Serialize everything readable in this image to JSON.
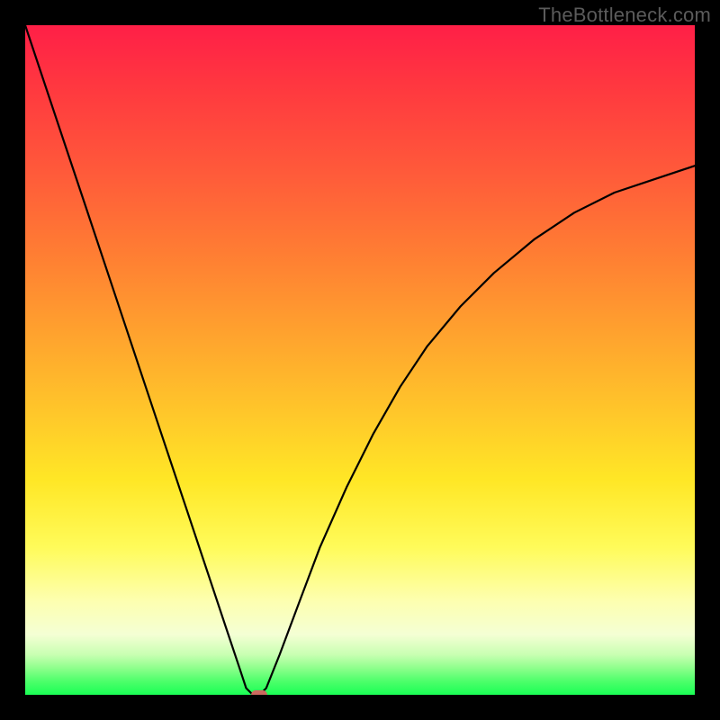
{
  "watermark": {
    "text": "TheBottleneck.com"
  },
  "chart_data": {
    "type": "line",
    "title": "",
    "xlabel": "",
    "ylabel": "",
    "xlim": [
      0,
      100
    ],
    "ylim": [
      0,
      100
    ],
    "grid": false,
    "background_gradient": {
      "direction": "vertical",
      "stops": [
        {
          "pos": 0.0,
          "color": "#ff1f47"
        },
        {
          "pos": 0.22,
          "color": "#ff5a3a"
        },
        {
          "pos": 0.46,
          "color": "#ffa22e"
        },
        {
          "pos": 0.68,
          "color": "#ffe726"
        },
        {
          "pos": 0.86,
          "color": "#fdffb0"
        },
        {
          "pos": 0.94,
          "color": "#c9ffb2"
        },
        {
          "pos": 1.0,
          "color": "#1aff55"
        }
      ]
    },
    "min_point": {
      "x": 34,
      "y": 0
    },
    "marker": {
      "x": 35,
      "y": 0,
      "color": "#cc6a5f"
    },
    "series": [
      {
        "name": "bottleneck-curve",
        "color": "#000000",
        "x": [
          0,
          3,
          6,
          9,
          12,
          15,
          18,
          21,
          24,
          27,
          30,
          32,
          33,
          34,
          35,
          36,
          38,
          41,
          44,
          48,
          52,
          56,
          60,
          65,
          70,
          76,
          82,
          88,
          94,
          100
        ],
        "y": [
          100,
          91,
          82,
          73,
          64,
          55,
          46,
          37,
          28,
          19,
          10,
          4,
          1,
          0,
          0,
          1,
          6,
          14,
          22,
          31,
          39,
          46,
          52,
          58,
          63,
          68,
          72,
          75,
          77,
          79
        ]
      }
    ]
  }
}
